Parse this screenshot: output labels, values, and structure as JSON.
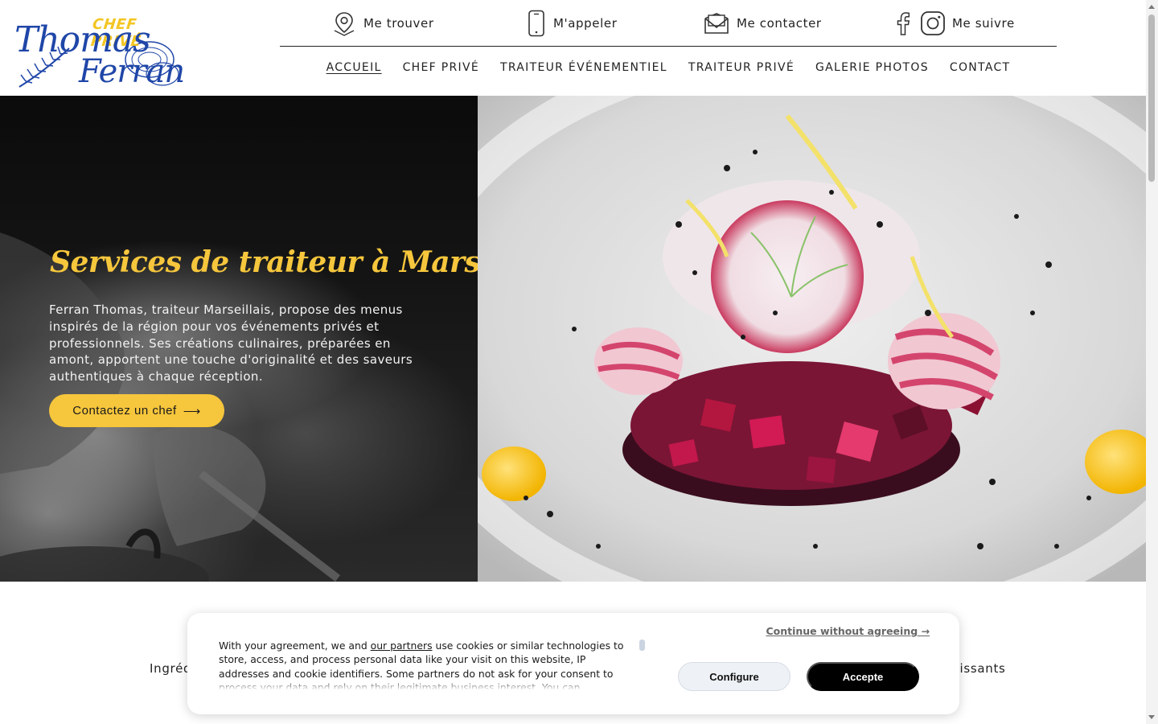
{
  "brand": {
    "logo_top": "CHEF PRIVÉ",
    "logo_line1": "Thomas",
    "logo_line2": "Ferran",
    "primary_color": "#1f46a8",
    "accent_color": "#f6c63c"
  },
  "topbar": {
    "locate": {
      "label": "Me trouver",
      "icon": "map-pin-icon"
    },
    "call": {
      "label": "M'appeler",
      "icon": "phone-icon"
    },
    "contact": {
      "label": "Me contacter",
      "icon": "envelope-icon"
    },
    "follow": {
      "label": "Me suivre",
      "icons": [
        "facebook-icon",
        "instagram-icon"
      ]
    }
  },
  "nav": {
    "items": [
      {
        "label": "ACCUEIL",
        "active": true
      },
      {
        "label": "CHEF PRIVÉ",
        "active": false
      },
      {
        "label": "TRAITEUR ÉVÉNEMENTIEL",
        "active": false
      },
      {
        "label": "TRAITEUR PRIVÉ",
        "active": false
      },
      {
        "label": "GALERIE PHOTOS",
        "active": false
      },
      {
        "label": "CONTACT",
        "active": false
      }
    ]
  },
  "hero": {
    "title": "Services de traiteur à Marseille",
    "text": "Ferran Thomas, traiteur Marseillais, propose des menus inspirés de la région pour vos événements privés et professionnels. Ses créations culinaires, préparées en amont, apportent une touche d'originalité et des saveurs authentiques à chaque réception.",
    "cta_label": "Contactez un chef",
    "cta_arrow": "⟶"
  },
  "below": {
    "feature_left": "Ingréd",
    "feature_right": "rrissants"
  },
  "cookie": {
    "text_before_link": "With your agreement, we and ",
    "link_text": "our partners",
    "text_after_link": " use cookies or similar technologies to store, access, and process personal data like your visit on this website, IP addresses and cookie identifiers. Some partners do not ask for your consent to process your data and rely on their legitimate business interest. You can",
    "continue_label": "Continue without agreeing →",
    "configure_label": "Configure",
    "accept_label": "Accepte"
  }
}
